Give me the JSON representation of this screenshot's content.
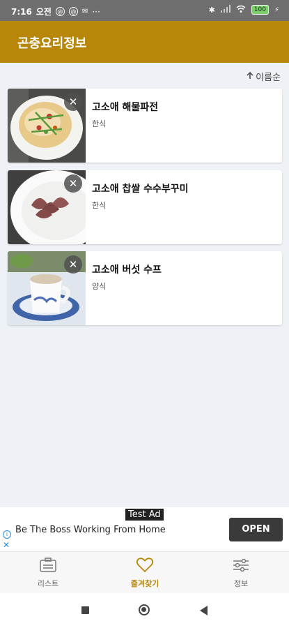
{
  "status": {
    "time": "7:16",
    "ampm": "오전",
    "left_icons": [
      "@",
      "@",
      "✉",
      "···"
    ],
    "battery": "100"
  },
  "appbar": {
    "title": "곤충요리정보"
  },
  "sort": {
    "label": "이름순",
    "icon": "arrow-up-icon"
  },
  "items": [
    {
      "title": "고소애 해물파전",
      "category": "한식",
      "image": "pajeon-plate"
    },
    {
      "title": "고소애 찹쌀 수수부꾸미",
      "category": "한식",
      "image": "bukkumi-plate"
    },
    {
      "title": "고소애 버섯 수프",
      "category": "양식",
      "image": "soup-cup"
    }
  ],
  "ad": {
    "tag": "Test Ad",
    "text": "Be The Boss Working From Home",
    "button": "OPEN"
  },
  "nav": {
    "tabs": [
      {
        "label": "리스트",
        "icon": "list-icon"
      },
      {
        "label": "즐겨찾기",
        "icon": "heart-icon",
        "active": true
      },
      {
        "label": "정보",
        "icon": "settings-sliders-icon"
      }
    ]
  },
  "colors": {
    "accent": "#b8870a",
    "statusbar": "#6e6e6e",
    "background": "#eef1f5"
  }
}
